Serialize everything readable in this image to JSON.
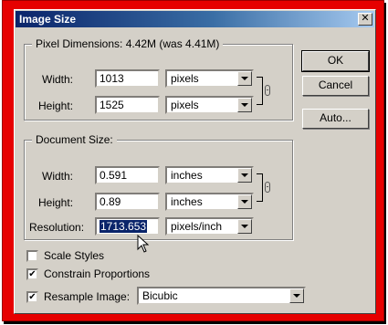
{
  "dialog": {
    "title": "Image Size",
    "close_glyph": "✕"
  },
  "pixel_dimensions": {
    "legend": "Pixel Dimensions:  4.42M (was 4.41M)",
    "width_label": "Width:",
    "width_value": "1013",
    "width_unit": "pixels",
    "height_label": "Height:",
    "height_value": "1525",
    "height_unit": "pixels"
  },
  "document_size": {
    "legend": "Document Size:",
    "width_label": "Width:",
    "width_value": "0.591",
    "width_unit": "inches",
    "height_label": "Height:",
    "height_value": "0.89",
    "height_unit": "inches",
    "resolution_label": "Resolution:",
    "resolution_value": "1713.653",
    "resolution_unit": "pixels/inch"
  },
  "buttons": {
    "ok": "OK",
    "cancel": "Cancel",
    "auto": "Auto..."
  },
  "options": {
    "scale_styles": {
      "label": "Scale Styles",
      "checked": false
    },
    "constrain_proportions": {
      "label": "Constrain Proportions",
      "checked": true
    },
    "resample_image": {
      "label": "Resample Image:",
      "checked": true,
      "method": "Bicubic"
    }
  },
  "icons": {
    "chain_link": "chain-link-icon",
    "mouse_cursor": "arrow-cursor-icon"
  },
  "colors": {
    "frame": "#e60000",
    "dialog_bg": "#d4d0c8",
    "title_start": "#0a246a",
    "title_end": "#a6caf0",
    "selection": "#0a246a"
  }
}
